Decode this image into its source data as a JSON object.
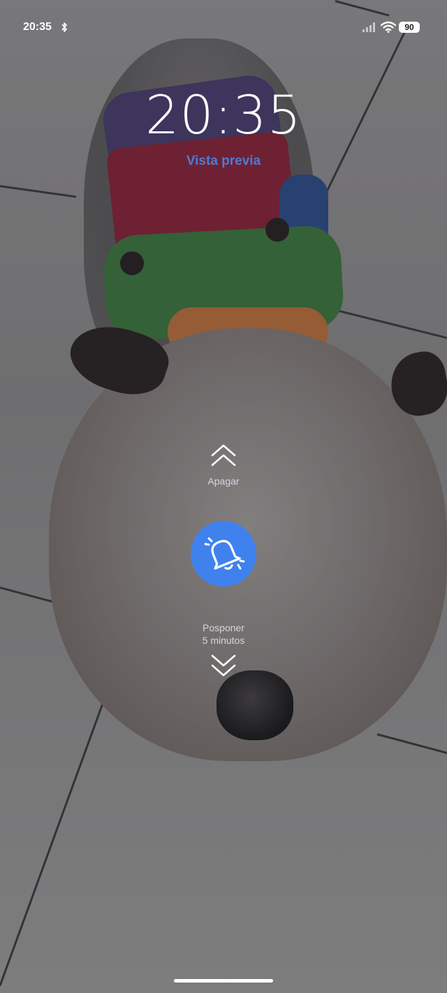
{
  "status_bar": {
    "time": "20:35",
    "battery": "90",
    "icons": [
      "bluetooth-icon",
      "signal-icon",
      "wifi-icon",
      "battery-icon"
    ]
  },
  "lockscreen": {
    "clock": "20:35",
    "preview_label": "Vista previa"
  },
  "alarm": {
    "dismiss_label": "Apagar",
    "snooze_line1": "Posponer",
    "snooze_line2": "5 minutos",
    "icon": "alarm-bell-icon",
    "button_color": "#3f82ee"
  },
  "colors": {
    "preview_text": "#4d7bd8",
    "accent": "#3f82ee"
  }
}
